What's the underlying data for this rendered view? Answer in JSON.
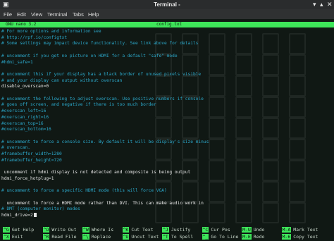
{
  "window": {
    "title": "Terminal -"
  },
  "menu": [
    "File",
    "Edit",
    "View",
    "Terminal",
    "Tabs",
    "Help"
  ],
  "nano": {
    "version": "GNU nano 3.2",
    "filename": "config.txt"
  },
  "lines": [
    {
      "text": "# For more options and information see",
      "type": "comment"
    },
    {
      "text": "# http://rpf.io/configtxt",
      "type": "comment"
    },
    {
      "text": "# Some settings may impact device functionality. See link above for details",
      "type": "comment"
    },
    {
      "text": "",
      "type": "blank"
    },
    {
      "text": "# uncomment if you get no picture on HDMI for a default \"safe\" mode",
      "type": "comment"
    },
    {
      "text": "#hdmi_safe=1",
      "type": "comment"
    },
    {
      "text": "",
      "type": "blank"
    },
    {
      "text": "# uncomment this if your display has a black border of unused pixels visible",
      "type": "comment"
    },
    {
      "text": "# and your display can output without overscan",
      "type": "comment"
    },
    {
      "text": "disable_overscan=0",
      "type": "text"
    },
    {
      "text": "",
      "type": "blank"
    },
    {
      "text": "# uncomment the following to adjust overscan. Use positive numbers if console",
      "type": "comment"
    },
    {
      "text": "# goes off screen, and negative if there is too much border",
      "type": "comment"
    },
    {
      "text": "#overscan_left=16",
      "type": "comment"
    },
    {
      "text": "#overscan_right=16",
      "type": "comment"
    },
    {
      "text": "#overscan_top=16",
      "type": "comment"
    },
    {
      "text": "#overscan_bottom=16",
      "type": "comment"
    },
    {
      "text": "",
      "type": "blank"
    },
    {
      "text": "# uncomment to force a console size. By default it will be display's size minus",
      "type": "comment"
    },
    {
      "text": "# overscan.",
      "type": "comment"
    },
    {
      "text": "#framebuffer_width=1280",
      "type": "comment"
    },
    {
      "text": "#framebuffer_height=720",
      "type": "comment"
    },
    {
      "text": "",
      "type": "blank"
    },
    {
      "text": " uncomment if hdmi display is not detected and composite is being output",
      "type": "text"
    },
    {
      "text": "hdmi_force_hotplug=1",
      "type": "text"
    },
    {
      "text": "",
      "type": "blank"
    },
    {
      "text": "# uncomment to force a specific HDMI mode (this will force VGA)",
      "type": "comment"
    },
    {
      "text": "",
      "type": "blank"
    },
    {
      "text": "  uncomment to force a HDMI mode rather than DVI. This can make audio work in",
      "type": "text"
    },
    {
      "text": "# DMT (computer monitor) modes",
      "type": "comment"
    },
    {
      "text": "hdmi_drive=2",
      "type": "text",
      "cursor": true
    }
  ],
  "shortcuts": [
    {
      "key": "^G",
      "label": "Get Help"
    },
    {
      "key": "^X",
      "label": "Exit"
    },
    {
      "key": "^O",
      "label": "Write Out"
    },
    {
      "key": "^R",
      "label": "Read File"
    },
    {
      "key": "^W",
      "label": "Where Is"
    },
    {
      "key": "^\\",
      "label": "Replace"
    },
    {
      "key": "^K",
      "label": "Cut Text"
    },
    {
      "key": "^U",
      "label": "Uncut Text"
    },
    {
      "key": "^J",
      "label": "Justify"
    },
    {
      "key": "^T",
      "label": "To Spell"
    },
    {
      "key": "^C",
      "label": "Cur Pos"
    },
    {
      "key": "^_",
      "label": "Go To Line"
    },
    {
      "key": "M-U",
      "label": "Undo"
    },
    {
      "key": "M-E",
      "label": "Redo"
    },
    {
      "key": "M-A",
      "label": "Mark Text"
    },
    {
      "key": "M-6",
      "label": "Copy Text"
    }
  ],
  "colors": {
    "accent": "#3ee65a",
    "comment": "#2ba7c9",
    "text": "#e6e6e6"
  }
}
